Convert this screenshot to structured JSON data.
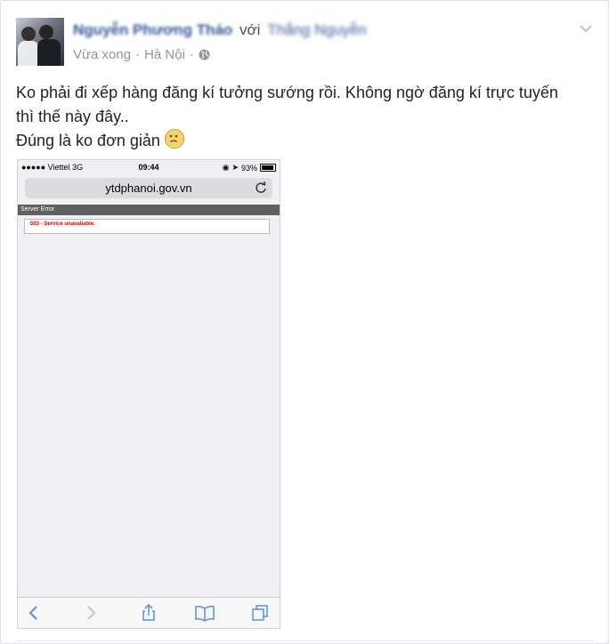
{
  "post": {
    "author": "Nguyễn Phương Thảo",
    "with_text": "với",
    "tagged": "Thắng Nguyễn",
    "time": "Vừa xong",
    "separator": "·",
    "location": "Hà Nội",
    "audience_icon": "globe-icon",
    "menu_icon": "chevron-down-icon",
    "text_lines": [
      "Ko phải đi xếp hàng đăng kí tưởng sướng rồi. Không ngờ đăng kí trực tuyến",
      "thì thế này đây..",
      "Đúng là ko đơn giản"
    ],
    "emoji": "frown-emoji"
  },
  "phone": {
    "carrier": "●●●●● Viettel",
    "network": "3G",
    "time": "09:44",
    "battery": "93%",
    "battery_level": 0.93,
    "url": "ytdphanoi.gov.vn",
    "error_header": "Server Error",
    "error_message": "503 - Service unavailable.",
    "toolbar_icons": [
      "back-icon",
      "forward-icon",
      "share-icon",
      "bookmarks-icon",
      "tabs-icon"
    ]
  },
  "colors": {
    "link": "#365899",
    "meta": "#90949c",
    "text": "#1d2129",
    "error": "#cc0000"
  }
}
